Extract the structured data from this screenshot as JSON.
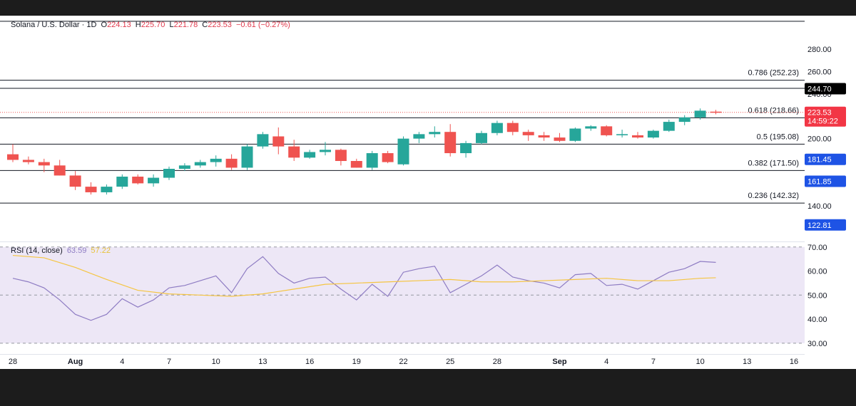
{
  "header": {
    "symbol": "Solana / U.S. Dollar · 1D",
    "o_label": "O",
    "o_value": "224.13",
    "h_label": "H",
    "h_value": "225.70",
    "l_label": "L",
    "l_value": "221.78",
    "c_label": "C",
    "c_value": "223.53",
    "change": "−0.61 (−0.27%)"
  },
  "rsi_header": {
    "label": "RSI (14, close)",
    "rsi_value": "63.59",
    "ma_value": "57.22"
  },
  "colors": {
    "up": "#26a69a",
    "down": "#ef5350",
    "rsi_line": "#8e7cc3",
    "rsi_ma": "#f5c542",
    "rsi_band": "#ede7f6",
    "axis_text": "#131722",
    "price_badge": "#f23645",
    "blue_badge": "#1e53e5",
    "black_badge": "#000000"
  },
  "chart_data": [
    {
      "type": "candlestick",
      "title": "Solana / U.S. Dollar · 1D",
      "x_tick_labels": [
        {
          "label": "28",
          "day": 0
        },
        {
          "label": "Aug",
          "day": 4
        },
        {
          "label": "4",
          "day": 7
        },
        {
          "label": "7",
          "day": 10
        },
        {
          "label": "10",
          "day": 13
        },
        {
          "label": "13",
          "day": 16
        },
        {
          "label": "16",
          "day": 19
        },
        {
          "label": "19",
          "day": 22
        },
        {
          "label": "22",
          "day": 25
        },
        {
          "label": "25",
          "day": 28
        },
        {
          "label": "28",
          "day": 31
        },
        {
          "label": "Sep",
          "day": 35
        },
        {
          "label": "4",
          "day": 38
        },
        {
          "label": "7",
          "day": 41
        },
        {
          "label": "10",
          "day": 44
        },
        {
          "label": "13",
          "day": 47
        },
        {
          "label": "16",
          "day": 50
        }
      ],
      "ylim": [
        108,
        310
      ],
      "y_ticks": [
        140,
        160,
        180,
        200,
        220,
        240,
        260,
        280
      ],
      "y_tick_labels": [
        "140.00",
        "",
        "",
        "200.00",
        "",
        "240.00",
        "260.00",
        "280.00"
      ],
      "candles": [
        {
          "day": 0,
          "o": 186,
          "h": 195,
          "l": 179,
          "c": 181
        },
        {
          "day": 1,
          "o": 181,
          "h": 184,
          "l": 177,
          "c": 179
        },
        {
          "day": 2,
          "o": 179,
          "h": 182,
          "l": 170,
          "c": 176
        },
        {
          "day": 3,
          "o": 176,
          "h": 181,
          "l": 167,
          "c": 167
        },
        {
          "day": 4,
          "o": 167,
          "h": 171,
          "l": 154,
          "c": 157
        },
        {
          "day": 5,
          "o": 157,
          "h": 161,
          "l": 150,
          "c": 152
        },
        {
          "day": 6,
          "o": 152,
          "h": 159,
          "l": 150,
          "c": 157
        },
        {
          "day": 7,
          "o": 157,
          "h": 168,
          "l": 155,
          "c": 166
        },
        {
          "day": 8,
          "o": 166,
          "h": 168,
          "l": 159,
          "c": 160
        },
        {
          "day": 9,
          "o": 160,
          "h": 168,
          "l": 157,
          "c": 165
        },
        {
          "day": 10,
          "o": 165,
          "h": 175,
          "l": 163,
          "c": 173
        },
        {
          "day": 11,
          "o": 173,
          "h": 178,
          "l": 171,
          "c": 176
        },
        {
          "day": 12,
          "o": 176,
          "h": 181,
          "l": 174,
          "c": 179
        },
        {
          "day": 13,
          "o": 179,
          "h": 185,
          "l": 175,
          "c": 182
        },
        {
          "day": 14,
          "o": 182,
          "h": 186,
          "l": 172,
          "c": 174
        },
        {
          "day": 15,
          "o": 174,
          "h": 195,
          "l": 172,
          "c": 193
        },
        {
          "day": 16,
          "o": 193,
          "h": 206,
          "l": 191,
          "c": 204
        },
        {
          "day": 17,
          "o": 202,
          "h": 210,
          "l": 186,
          "c": 193
        },
        {
          "day": 18,
          "o": 193,
          "h": 199,
          "l": 180,
          "c": 183
        },
        {
          "day": 19,
          "o": 183,
          "h": 190,
          "l": 182,
          "c": 188
        },
        {
          "day": 20,
          "o": 188,
          "h": 197,
          "l": 185,
          "c": 190
        },
        {
          "day": 21,
          "o": 190,
          "h": 191,
          "l": 176,
          "c": 180
        },
        {
          "day": 22,
          "o": 180,
          "h": 182,
          "l": 174,
          "c": 174
        },
        {
          "day": 23,
          "o": 174,
          "h": 189,
          "l": 172,
          "c": 187
        },
        {
          "day": 24,
          "o": 187,
          "h": 189,
          "l": 178,
          "c": 179
        },
        {
          "day": 25,
          "o": 177,
          "h": 202,
          "l": 176,
          "c": 200
        },
        {
          "day": 26,
          "o": 200,
          "h": 206,
          "l": 196,
          "c": 204
        },
        {
          "day": 27,
          "o": 204,
          "h": 211,
          "l": 201,
          "c": 206
        },
        {
          "day": 28,
          "o": 206,
          "h": 213,
          "l": 184,
          "c": 187
        },
        {
          "day": 29,
          "o": 187,
          "h": 198,
          "l": 183,
          "c": 196
        },
        {
          "day": 30,
          "o": 196,
          "h": 207,
          "l": 195,
          "c": 205
        },
        {
          "day": 31,
          "o": 205,
          "h": 216,
          "l": 203,
          "c": 214
        },
        {
          "day": 32,
          "o": 214,
          "h": 216,
          "l": 203,
          "c": 206
        },
        {
          "day": 33,
          "o": 206,
          "h": 208,
          "l": 198,
          "c": 203
        },
        {
          "day": 34,
          "o": 203,
          "h": 206,
          "l": 198,
          "c": 201
        },
        {
          "day": 35,
          "o": 201,
          "h": 205,
          "l": 197,
          "c": 198
        },
        {
          "day": 36,
          "o": 198,
          "h": 210,
          "l": 197,
          "c": 209
        },
        {
          "day": 37,
          "o": 209,
          "h": 212,
          "l": 207,
          "c": 211
        },
        {
          "day": 38,
          "o": 211,
          "h": 212,
          "l": 202,
          "c": 203
        },
        {
          "day": 39,
          "o": 203,
          "h": 208,
          "l": 201,
          "c": 204
        },
        {
          "day": 40,
          "o": 203,
          "h": 206,
          "l": 200,
          "c": 201
        },
        {
          "day": 41,
          "o": 201,
          "h": 208,
          "l": 200,
          "c": 207
        },
        {
          "day": 42,
          "o": 207,
          "h": 217,
          "l": 206,
          "c": 215
        },
        {
          "day": 43,
          "o": 215,
          "h": 221,
          "l": 212,
          "c": 219
        },
        {
          "day": 44,
          "o": 219,
          "h": 227,
          "l": 217,
          "c": 225
        },
        {
          "day": 45,
          "o": 224.13,
          "h": 225.7,
          "l": 221.78,
          "c": 223.53
        }
      ],
      "fib_levels": [
        {
          "label": "0.786 (252.23)",
          "value": 252.23
        },
        {
          "label": "0.618 (218.66)",
          "value": 218.66
        },
        {
          "label": "0.5 (195.08)",
          "value": 195.08
        },
        {
          "label": "0.382 (171.50)",
          "value": 171.5
        },
        {
          "label": "0.236 (142.32)",
          "value": 142.32
        }
      ],
      "horizontal_lines": [
        305,
        245
      ],
      "price_badges": [
        {
          "label": "244.70",
          "value": 244.7,
          "style": "black"
        },
        {
          "label": "223.53",
          "sublabel": "14:59:22",
          "value": 223.53,
          "style": "red"
        },
        {
          "label": "181.45",
          "value": 181.45,
          "style": "blue"
        },
        {
          "label": "161.85",
          "value": 161.85,
          "style": "blue"
        },
        {
          "label": "122.81",
          "value": 122.81,
          "style": "blue"
        }
      ],
      "last_price": 223.53
    },
    {
      "type": "line",
      "title": "RSI (14, close)",
      "ylim": [
        27,
        72
      ],
      "y_ticks": [
        30,
        40,
        50,
        60,
        70
      ],
      "y_tick_labels": [
        "30.00",
        "40.00",
        "50.00",
        "60.00",
        "70.00"
      ],
      "band": [
        30,
        70
      ],
      "middle": 50,
      "series": [
        {
          "name": "RSI",
          "points": [
            [
              0,
              57
            ],
            [
              1,
              55.5
            ],
            [
              2,
              53
            ],
            [
              3,
              48
            ],
            [
              4,
              42
            ],
            [
              5,
              39.5
            ],
            [
              6,
              42
            ],
            [
              7,
              48.5
            ],
            [
              8,
              45
            ],
            [
              9,
              48
            ],
            [
              10,
              53
            ],
            [
              11,
              54
            ],
            [
              12,
              56
            ],
            [
              13,
              58
            ],
            [
              14,
              51
            ],
            [
              15,
              61
            ],
            [
              16,
              66
            ],
            [
              17,
              59
            ],
            [
              18,
              55
            ],
            [
              19,
              57
            ],
            [
              20,
              57.5
            ],
            [
              21,
              52.5
            ],
            [
              22,
              48
            ],
            [
              23,
              54.5
            ],
            [
              24,
              49.5
            ],
            [
              25,
              59.5
            ],
            [
              26,
              61
            ],
            [
              27,
              62
            ],
            [
              28,
              51
            ],
            [
              29,
              54.5
            ],
            [
              30,
              58
            ],
            [
              31,
              62.5
            ],
            [
              32,
              57.5
            ],
            [
              33,
              56
            ],
            [
              34,
              55
            ],
            [
              35,
              53
            ],
            [
              36,
              58.5
            ],
            [
              37,
              59
            ],
            [
              38,
              54
            ],
            [
              39,
              54.5
            ],
            [
              40,
              52.5
            ],
            [
              41,
              56
            ],
            [
              42,
              59.5
            ],
            [
              43,
              61
            ],
            [
              44,
              64
            ],
            [
              45,
              63.59
            ]
          ]
        },
        {
          "name": "RSI-based MA",
          "points": [
            [
              0,
              66.5
            ],
            [
              2,
              65.5
            ],
            [
              4,
              61.5
            ],
            [
              6,
              56.5
            ],
            [
              8,
              52
            ],
            [
              10,
              50.5
            ],
            [
              12,
              50
            ],
            [
              14,
              49.5
            ],
            [
              16,
              50.5
            ],
            [
              18,
              52.5
            ],
            [
              20,
              54.5
            ],
            [
              22,
              55
            ],
            [
              24,
              55.5
            ],
            [
              26,
              56
            ],
            [
              28,
              56.5
            ],
            [
              30,
              55.5
            ],
            [
              32,
              55.5
            ],
            [
              34,
              56
            ],
            [
              36,
              56.5
            ],
            [
              38,
              57
            ],
            [
              40,
              56
            ],
            [
              42,
              56
            ],
            [
              44,
              57
            ],
            [
              45,
              57.22
            ]
          ]
        }
      ]
    }
  ]
}
